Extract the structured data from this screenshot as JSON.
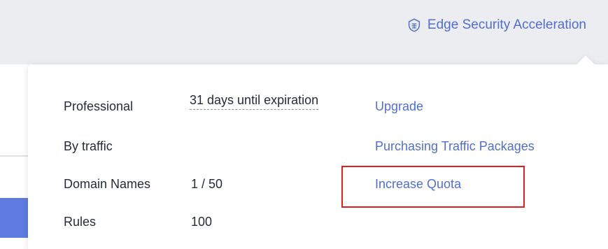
{
  "header": {
    "edge_link_label": "Edge Security Acceleration",
    "edge_icon": "shield-icon"
  },
  "popover": {
    "rows": [
      {
        "label": "Professional",
        "value": "31 days until expiration",
        "action": "Upgrade"
      },
      {
        "label": "By traffic",
        "value": "",
        "action": "Purchasing Traffic Packages"
      },
      {
        "label": "Domain Names",
        "value": "1 / 50",
        "action": "Increase Quota"
      },
      {
        "label": "Rules",
        "value": "100",
        "action": ""
      }
    ]
  },
  "colors": {
    "link": "#526ecc",
    "text": "#252b3a",
    "highlight": "#e02020",
    "accent_bar": "#5e7ce0"
  }
}
